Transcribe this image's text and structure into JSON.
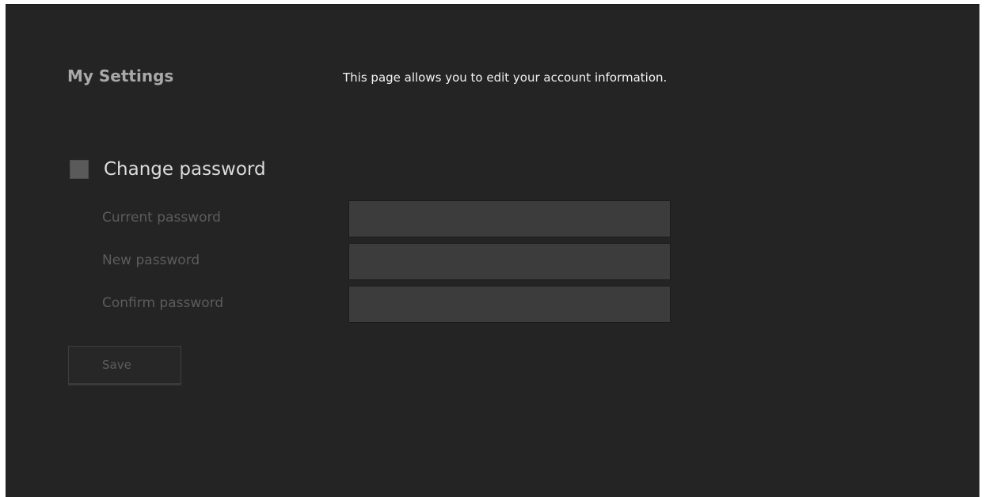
{
  "header": {
    "title": "My Settings",
    "description": "This page allows you to edit your account information."
  },
  "change_password": {
    "label": "Change password",
    "checked": false
  },
  "fields": [
    {
      "label": "Current password",
      "value": ""
    },
    {
      "label": "New password",
      "value": ""
    },
    {
      "label": "Confirm password",
      "value": ""
    }
  ],
  "actions": {
    "save_label": "Save"
  },
  "colors": {
    "background": "#242424",
    "input_background": "#3c3c3c",
    "checkbox": "#5a5a5a"
  }
}
